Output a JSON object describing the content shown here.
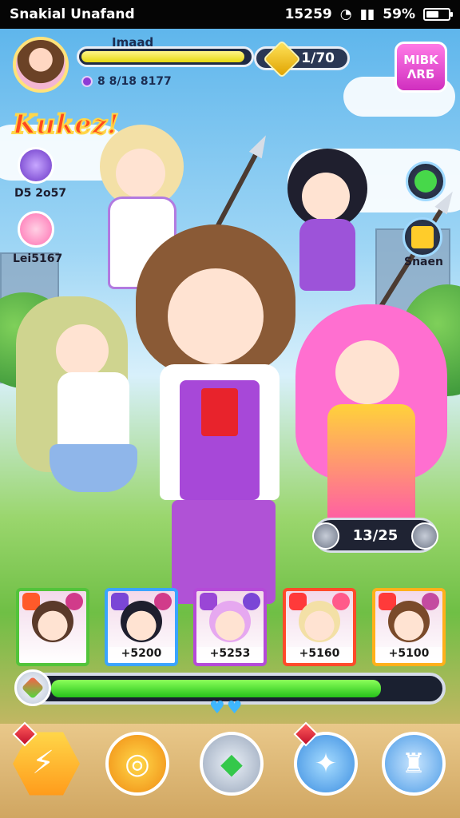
{
  "statusbar": {
    "carrier": "Snakial Unafand",
    "time": "15259",
    "battery": "59%",
    "battery_level": 0.59
  },
  "hud": {
    "profile_name": "Imaad",
    "xp_progress": 0.97,
    "currency_value": "1/70",
    "sub_label": "8 8/18 8177",
    "menu_label": "MIBK ΛRБ",
    "logo": "Kukez!"
  },
  "side": {
    "left": [
      {
        "label": "D5 2o57",
        "color": "#8a4be0"
      },
      {
        "label": "Lei5167",
        "color": "#ff77b5"
      }
    ],
    "right": [
      {
        "label": "",
        "icon": "gear-icon"
      },
      {
        "label": "Snaen",
        "icon": "chart-icon"
      }
    ]
  },
  "battle": {
    "counter": "13/25"
  },
  "party": [
    {
      "value": "",
      "border": "#52c43a"
    },
    {
      "value": "+5200",
      "border": "#3aa4ff"
    },
    {
      "value": "+5253",
      "border": "#b54ad8"
    },
    {
      "value": "+5160",
      "border": "#ff4a2a"
    },
    {
      "value": "+5100",
      "border": "#ffb01a"
    }
  ],
  "health": {
    "progress": 0.86
  },
  "actions": [
    {
      "name": "attack-button",
      "icon": "lightning-icon"
    },
    {
      "name": "skill-button",
      "icon": "swirl-icon"
    },
    {
      "name": "crystal-button",
      "icon": "crystal-icon"
    },
    {
      "name": "ability-button",
      "icon": "sword-icon"
    },
    {
      "name": "armor-button",
      "icon": "shirt-icon"
    }
  ],
  "colors": {
    "accent": "#ff4ad2",
    "xp": "#e6d90f",
    "hp": "#26c21a"
  }
}
